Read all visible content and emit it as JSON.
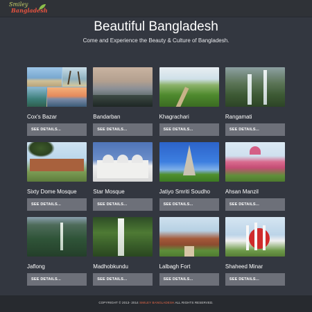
{
  "header": {
    "logo_text_top": "Smiley",
    "logo_text_bottom": "Bangladesh"
  },
  "hero": {
    "title": "Beautiful Bangladesh",
    "subtitle": "Come and Experience the Beauty & Culture of Bangladesh."
  },
  "places": [
    {
      "name": "Cox's Bazar",
      "button": "SEE DETAILS...",
      "image": "coxs-bazar-collage"
    },
    {
      "name": "Bandarban",
      "button": "SEE DETAILS...",
      "image": "bandarban-clouds"
    },
    {
      "name": "Khagrachari",
      "button": "SEE DETAILS...",
      "image": "khagrachari-hills"
    },
    {
      "name": "Rangamati",
      "button": "SEE DETAILS...",
      "image": "rangamati-waterfall"
    },
    {
      "name": "Sixty Dome Mosque",
      "button": "SEE DETAILS...",
      "image": "sixty-dome-mosque"
    },
    {
      "name": "Star Mosque",
      "button": "SEE DETAILS...",
      "image": "star-mosque"
    },
    {
      "name": "Jatiyo Smriti Soudho",
      "button": "SEE DETAILS...",
      "image": "jatiyo-smriti-soudho"
    },
    {
      "name": "Ahsan Manzil",
      "button": "SEE DETAILS...",
      "image": "ahsan-manzil"
    },
    {
      "name": "Jaflong",
      "button": "SEE DETAILS...",
      "image": "jaflong-waterfall"
    },
    {
      "name": "Madhobkundu",
      "button": "SEE DETAILS...",
      "image": "madhobkundu-waterfall"
    },
    {
      "name": "Lalbagh Fort",
      "button": "SEE DETAILS...",
      "image": "lalbagh-fort"
    },
    {
      "name": "Shaheed Minar",
      "button": "SEE DETAILS...",
      "image": "shaheed-minar"
    }
  ],
  "footer": {
    "prefix": "COPYRIGHT © 2013- 2014",
    "brand": "SMILEY BANGLADESH",
    "suffix": "ALL RIGHTS RESERVED."
  },
  "colors": {
    "background": "#333740",
    "topbar": "#2f3237",
    "button": "#6d7079",
    "footer": "#272a2f",
    "brand_accent": "#e86a4a"
  }
}
